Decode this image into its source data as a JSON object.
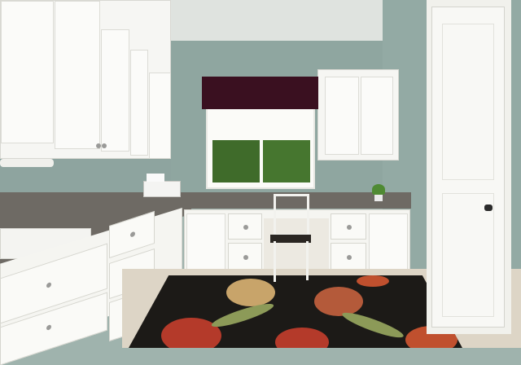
{
  "scene": {
    "description_free": true,
    "colors": {
      "wall": "#8fa6a0",
      "cabinet": "#f6f6f3",
      "counter": "#6e6a64",
      "valance": "#3a1020",
      "rug_base": "#1c1a17",
      "rug_flower_red": "#b43a2a",
      "rug_flower_tan": "#c8a46a",
      "rug_leaf": "#8c9a58"
    }
  }
}
